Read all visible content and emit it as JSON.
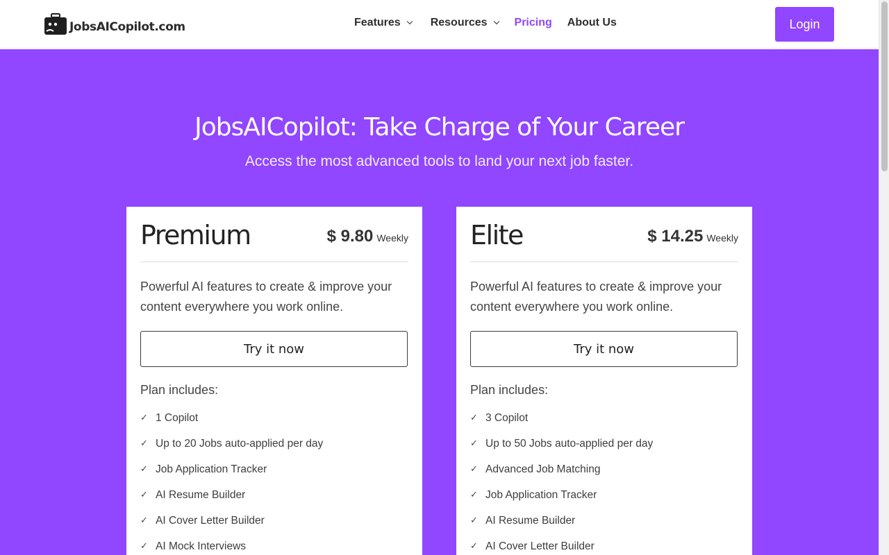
{
  "nav": {
    "logo_text": "JobsAICopilot.com",
    "items": [
      "Features",
      "Resources",
      "Pricing",
      "About Us"
    ],
    "login_label": "Login"
  },
  "hero": {
    "title": "JobsAICopilot: Take Charge of Your Career",
    "subtitle": "Access the most advanced tools to land your next job faster."
  },
  "plans": [
    {
      "name": "Premium",
      "price": "$ 9.80",
      "period": "Weekly",
      "description": "Powerful AI features to create & improve your content everywhere you work online.",
      "cta": "Try it now",
      "includes_label": "Plan includes:",
      "features": [
        "1 Copilot",
        "Up to 20 Jobs auto-applied per day",
        "Job Application Tracker",
        "AI Resume Builder",
        "AI Cover Letter Builder",
        "AI Mock Interviews"
      ]
    },
    {
      "name": "Elite",
      "price": "$ 14.25",
      "period": "Weekly",
      "description": "Powerful AI features to create & improve your content everywhere you work online.",
      "cta": "Try it now",
      "includes_label": "Plan includes:",
      "features": [
        "3 Copilot",
        "Up to 50 Jobs auto-applied per day",
        "Advanced Job Matching",
        "Job Application Tracker",
        "AI Resume Builder",
        "AI Cover Letter Builder"
      ]
    }
  ],
  "colors": {
    "accent": "#9146ff",
    "text": "#2e2e2e"
  },
  "icons": {
    "logo": "briefcase-robot-icon",
    "dropdown": "chevron-down-icon",
    "feature": "check-icon"
  }
}
